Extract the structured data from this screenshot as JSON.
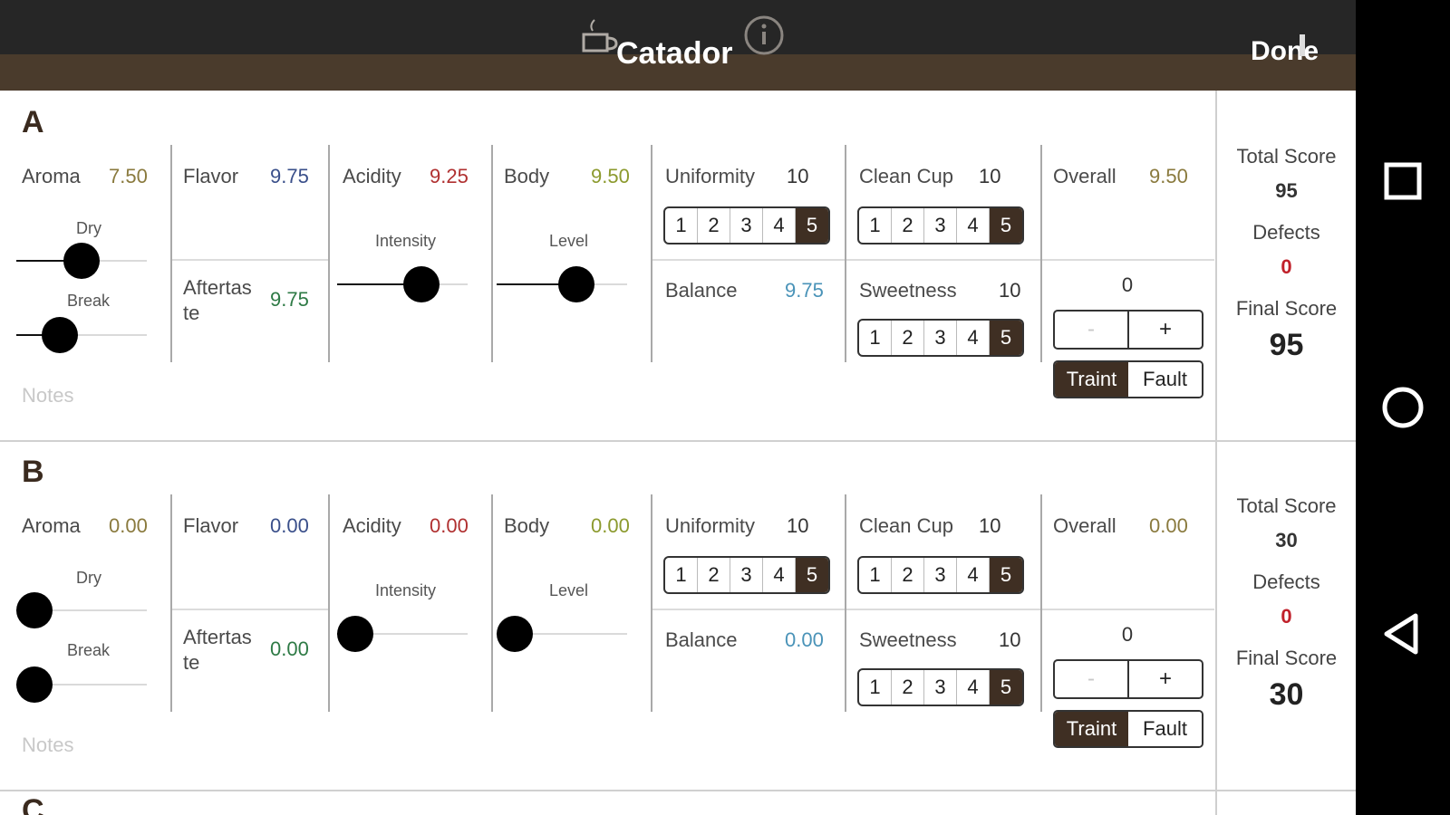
{
  "app": {
    "title": "Catador",
    "done_label": "Done"
  },
  "colors": {
    "accent": "#3f2f23",
    "aroma": "#8a7a3e",
    "flavor": "#3a4f8a",
    "acidity": "#b03030",
    "body": "#8c9a2e",
    "balance": "#4a93b8",
    "overall": "#8a7a3e",
    "aftertaste": "#2e7a45",
    "defect": "#c0202a"
  },
  "icons": {
    "cup": "coffee-cup-icon",
    "info": "info-icon",
    "recents": "square-icon",
    "home": "circle-icon",
    "back": "triangle-back-icon"
  },
  "labels": {
    "aroma": "Aroma",
    "dry": "Dry",
    "break": "Break",
    "flavor": "Flavor",
    "aftertaste": "Aftertas\nte",
    "acidity": "Acidity",
    "intensity": "Intensity",
    "body": "Body",
    "level": "Level",
    "uniformity": "Uniformity",
    "balance": "Balance",
    "clean_cup": "Clean Cup",
    "sweetness": "Sweetness",
    "overall": "Overall",
    "minus": "-",
    "plus": "+",
    "taint": "Traint",
    "fault": "Fault",
    "total_score": "Total Score",
    "defects": "Defects",
    "final_score": "Final Score",
    "notes_placeholder": "Notes"
  },
  "cup_options": [
    "1",
    "2",
    "3",
    "4",
    "5"
  ],
  "samples": [
    {
      "label": "A",
      "aroma": "7.50",
      "flavor": "9.75",
      "aftertaste": "9.75",
      "acidity": "9.25",
      "body": "9.50",
      "uniformity": "10",
      "balance": "9.75",
      "clean_cup": "10",
      "sweetness": "10",
      "overall": "9.50",
      "dry_level": 0.5,
      "break_level": 0.27,
      "intensity_level": 0.7,
      "body_level": 0.65,
      "uniformity_selected": 5,
      "clean_cup_selected": 5,
      "sweetness_selected": 5,
      "defect_count": "0",
      "defect_type": "Traint",
      "total_score": "95",
      "defects": "0",
      "final_score": "95"
    },
    {
      "label": "B",
      "aroma": "0.00",
      "flavor": "0.00",
      "aftertaste": "0.00",
      "acidity": "0.00",
      "body": "0.00",
      "uniformity": "10",
      "balance": "0.00",
      "clean_cup": "10",
      "sweetness": "10",
      "overall": "0.00",
      "dry_level": 0.0,
      "break_level": 0.0,
      "intensity_level": 0.0,
      "body_level": 0.0,
      "uniformity_selected": 5,
      "clean_cup_selected": 5,
      "sweetness_selected": 5,
      "defect_count": "0",
      "defect_type": "Traint",
      "total_score": "30",
      "defects": "0",
      "final_score": "30"
    }
  ],
  "next_sample_label": "C"
}
